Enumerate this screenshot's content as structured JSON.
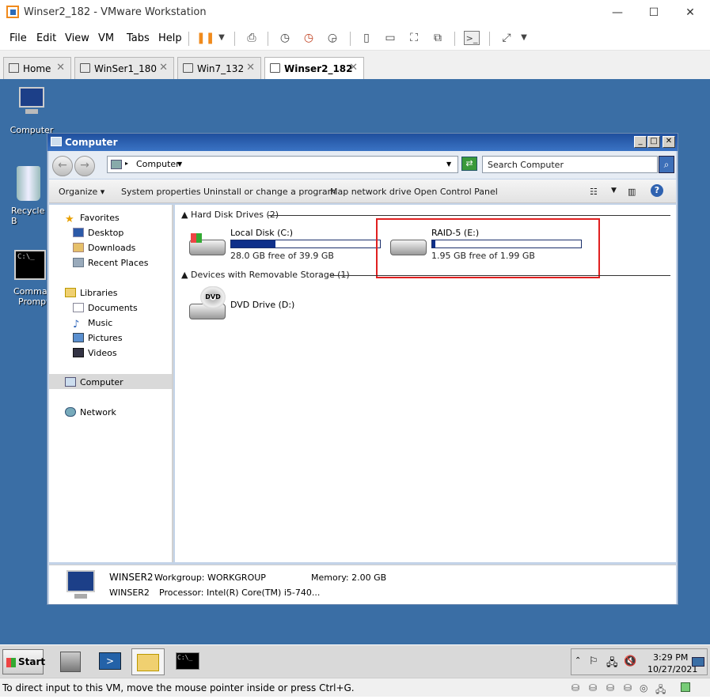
{
  "vm": {
    "title": "Winser2_182 - VMware Workstation",
    "menu": [
      "File",
      "Edit",
      "View",
      "VM",
      "Tabs",
      "Help"
    ],
    "tabs": [
      {
        "label": "Home"
      },
      {
        "label": "WinSer1_180"
      },
      {
        "label": "Win7_132"
      },
      {
        "label": "Winser2_182"
      }
    ],
    "status": "To direct input to this VM, move the mouse pointer inside or press Ctrl+G."
  },
  "desktop": {
    "icons": [
      {
        "label": "Computer"
      },
      {
        "label": "Recycle B"
      },
      {
        "label": "Comman"
      },
      {
        "label": "Prompt"
      }
    ]
  },
  "explorer": {
    "title": "Computer",
    "address": "Computer",
    "search_placeholder": "Search Computer",
    "commands": [
      "Organize",
      "System properties",
      "Uninstall or change a program",
      "Map network drive",
      "Open Control Panel"
    ],
    "nav": {
      "favorites": "Favorites",
      "desktop": "Desktop",
      "downloads": "Downloads",
      "recent": "Recent Places",
      "libraries": "Libraries",
      "documents": "Documents",
      "music": "Music",
      "pictures": "Pictures",
      "videos": "Videos",
      "computer": "Computer",
      "network": "Network"
    },
    "groups": {
      "hdd": "Hard Disk Drives (2)",
      "removable": "Devices with Removable Storage (1)"
    },
    "drives": [
      {
        "name": "Local Disk (C:)",
        "free": "28.0 GB free of 39.9 GB",
        "used_fraction": 0.3
      },
      {
        "name": "RAID-5 (E:)",
        "free": "1.95 GB free of 1.99 GB",
        "used_fraction": 0.02
      },
      {
        "name": "DVD Drive (D:)"
      }
    ],
    "details": {
      "name": "WINSER2",
      "workgroup": "Workgroup: WORKGROUP",
      "memory": "Memory: 2.00 GB",
      "name2": "WINSER2",
      "processor": "Processor: Intel(R) Core(TM) i5-740..."
    }
  },
  "taskbar": {
    "start": "Start",
    "time": "3:29 PM",
    "date": "10/27/2021"
  },
  "colors": {
    "desktop": "#3a6ea5",
    "highlight": "#e02020",
    "bar": "#0e2f8a"
  }
}
